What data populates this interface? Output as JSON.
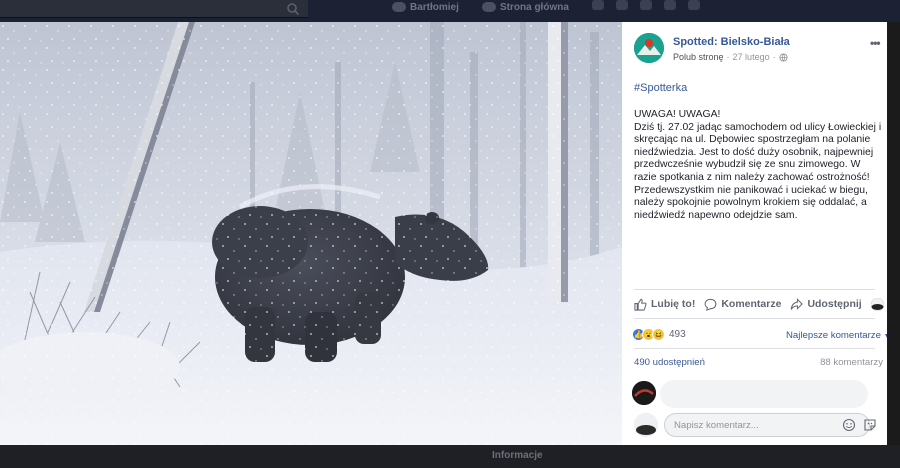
{
  "topbar": {
    "user_name": "Bartłomiej",
    "home_label": "Strona główna"
  },
  "post": {
    "page_name": "Spotted: Bielsko-Biała",
    "like_page_label": "Polub stronę",
    "separator": "·",
    "date": "27 lutego",
    "hashtag": "#Spotterka",
    "paragraph_1": "UWAGA! UWAGA!",
    "paragraph_2": "Dziś tj. 27.02 jadąc samochodem od ulicy Łowieckiej i skręcając na ul. Dębowiec spostrzegłam na polanie niedźwiedzia. Jest to dość duży osobnik, najpewniej przedwcześnie wybudził się ze snu zimowego. W razie spotkania z nim należy zachować ostrożność! Przedewszystkim nie panikować i uciekać w biegu, należy spokojnie powolnym krokiem się oddalać, a niedźwiedź napewno odejdzie sam."
  },
  "actions": {
    "like_label": "Lubię to!",
    "comment_label": "Komentarze",
    "share_label": "Udostępnij"
  },
  "stats": {
    "reaction_count": "493",
    "sort_label": "Najlepsze komentarze",
    "shares_label": "490 udostępnień",
    "comments_label": "88 komentarzy"
  },
  "composer": {
    "placeholder": "Napisz komentarz..."
  },
  "page_bottom": {
    "info_label": "Informacje"
  },
  "icons": [
    "search-icon",
    "globe-icon",
    "more-icon",
    "like-icon",
    "comment-icon",
    "share-icon",
    "emoji-icon",
    "sticker-icon"
  ],
  "colors": {
    "link_blue": "#365899",
    "like_blue": "#3578e5",
    "page_avatar": "#1aa190"
  }
}
